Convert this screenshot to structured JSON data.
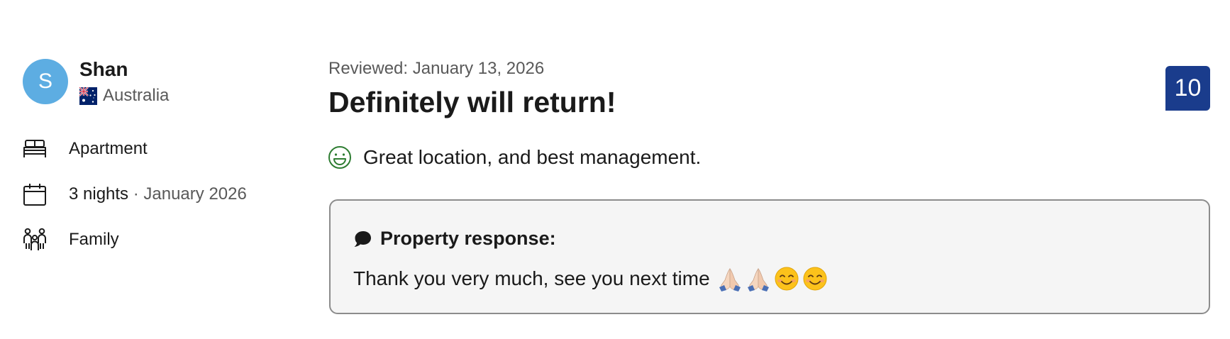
{
  "reviewer": {
    "initial": "S",
    "name": "Shan",
    "country": "Australia",
    "flag_icon": "australia-flag-icon",
    "avatar_color": "#5dade2"
  },
  "stay": {
    "room_type": "Apartment",
    "nights": "3 nights",
    "separator": " · ",
    "stay_date": "January 2026",
    "traveler_type": "Family"
  },
  "review": {
    "reviewed_label": "Reviewed: January 13, 2026",
    "title": "Definitely will return!",
    "score": "10",
    "score_color": "#1a3c8c",
    "positive_text": "Great location, and best management.",
    "positive_icon": "smile-face-icon",
    "positive_icon_color": "#2e7d32"
  },
  "property_response": {
    "label": "Property response:",
    "text": "Thank you very much, see you next time",
    "emojis": [
      "folded-hands",
      "folded-hands",
      "smiling-face",
      "smiling-face"
    ]
  }
}
